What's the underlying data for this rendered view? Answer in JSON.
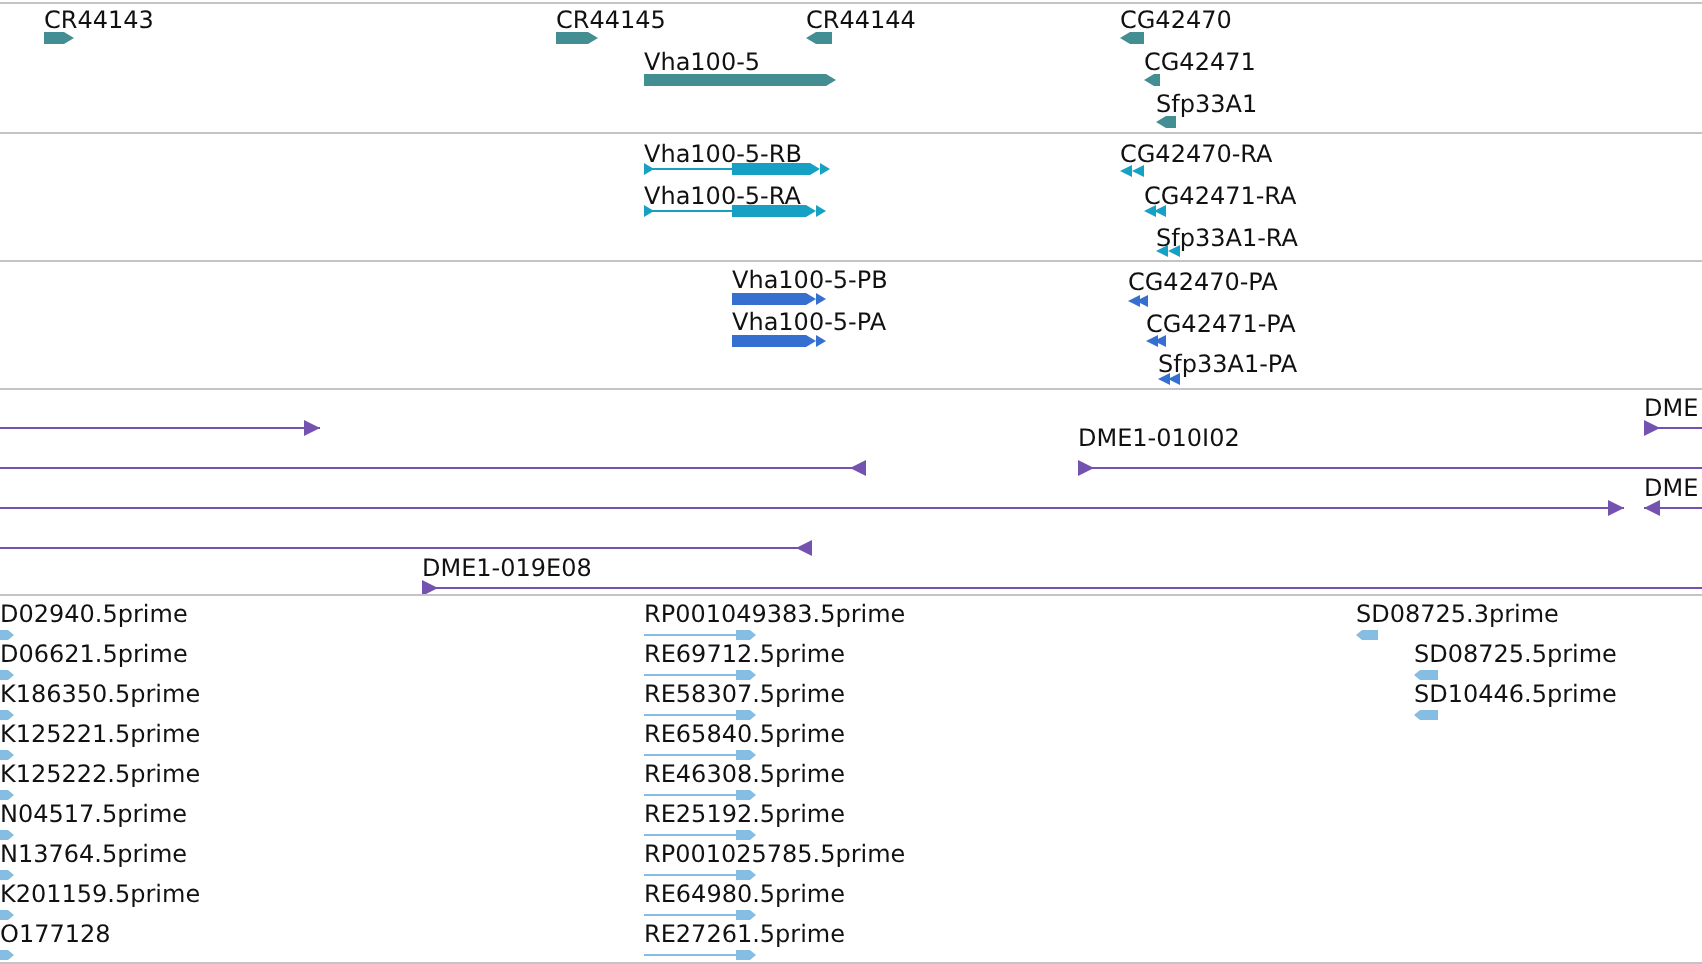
{
  "tracks": [
    {
      "kind": "gene",
      "features": [
        {
          "label": "CR44143",
          "reverse": false
        },
        {
          "label": "CR44145",
          "reverse": false
        },
        {
          "label": "CR44144",
          "reverse": true
        },
        {
          "label": "Vha100-5",
          "reverse": false
        },
        {
          "label": "CG42470",
          "reverse": true
        },
        {
          "label": "CG42471",
          "reverse": true
        },
        {
          "label": "Sfp33A1",
          "reverse": true
        }
      ]
    },
    {
      "kind": "transcript",
      "features": [
        {
          "label": "Vha100-5-RB",
          "reverse": false
        },
        {
          "label": "Vha100-5-RA",
          "reverse": false
        },
        {
          "label": "CG42470-RA",
          "reverse": true
        },
        {
          "label": "CG42471-RA",
          "reverse": true
        },
        {
          "label": "Sfp33A1-RA",
          "reverse": true
        }
      ]
    },
    {
      "kind": "protein",
      "features": [
        {
          "label": "Vha100-5-PB",
          "reverse": false
        },
        {
          "label": "Vha100-5-PA",
          "reverse": false
        },
        {
          "label": "CG42470-PA",
          "reverse": true
        },
        {
          "label": "CG42471-PA",
          "reverse": true
        },
        {
          "label": "Sfp33A1-PA",
          "reverse": true
        }
      ]
    },
    {
      "kind": "clone",
      "features": [
        {
          "reverse": false
        },
        {
          "reverse": true
        },
        {
          "label": "DME1-010I02",
          "reverse": false
        },
        {
          "label": "DME",
          "reverse": false
        },
        {
          "reverse": false
        },
        {
          "label": "DME",
          "reverse": true
        },
        {
          "reverse": true
        },
        {
          "label": "DME1-019E08",
          "reverse": false
        }
      ]
    },
    {
      "kind": "est",
      "features": [
        {
          "label": "D02940.5prime",
          "reverse": false
        },
        {
          "label": "D06621.5prime",
          "reverse": false
        },
        {
          "label": "K186350.5prime",
          "reverse": false
        },
        {
          "label": "K125221.5prime",
          "reverse": false
        },
        {
          "label": "K125222.5prime",
          "reverse": false
        },
        {
          "label": "N04517.5prime",
          "reverse": false
        },
        {
          "label": "N13764.5prime",
          "reverse": false
        },
        {
          "label": "K201159.5prime",
          "reverse": false
        },
        {
          "label": "O177128",
          "reverse": false
        },
        {
          "label": "RP001049383.5prime",
          "reverse": false
        },
        {
          "label": "RE69712.5prime",
          "reverse": false
        },
        {
          "label": "RE58307.5prime",
          "reverse": false
        },
        {
          "label": "RE65840.5prime",
          "reverse": false
        },
        {
          "label": "RE46308.5prime",
          "reverse": false
        },
        {
          "label": "RE25192.5prime",
          "reverse": false
        },
        {
          "label": "RP001025785.5prime",
          "reverse": false
        },
        {
          "label": "RE64980.5prime",
          "reverse": false
        },
        {
          "label": "RE27261.5prime",
          "reverse": false
        },
        {
          "label": "SD08725.3prime",
          "reverse": true
        },
        {
          "label": "SD08725.5prime",
          "reverse": true
        },
        {
          "label": "SD10446.5prime",
          "reverse": true
        }
      ]
    }
  ]
}
